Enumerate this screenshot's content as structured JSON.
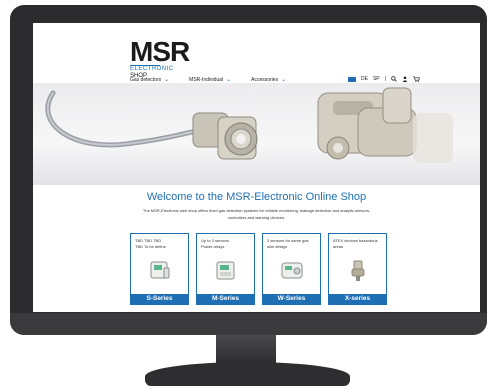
{
  "logo": {
    "main": "MSR",
    "line2": "ELECTRONIC",
    "line3": "SHOP"
  },
  "nav": [
    {
      "label": "Gas detectors"
    },
    {
      "label": "MSR-Individual"
    },
    {
      "label": "Accessories"
    }
  ],
  "utility": {
    "lang1": "DE",
    "lang2": "SP"
  },
  "welcome_title": "Welcome to the MSR-Electronic Online Shop",
  "description": [
    "The MSR-Electronic web shop offers fixed gas detection systems for reliable monitoring, leakage detection and analytic sensors,",
    "controllers and warning devices."
  ],
  "cards": [
    {
      "text": [
        "TBD TBD TBD",
        "TBD To be define"
      ],
      "label": "S-Series"
    },
    {
      "text": [
        "Up to 3 sensors",
        "Power-relays"
      ],
      "label": "M-Series"
    },
    {
      "text": [
        "2 sensors for same gas",
        "slim design"
      ],
      "label": "W-Series"
    },
    {
      "text": [
        "ATEX devices hazardous",
        "areas"
      ],
      "label": "X-series"
    }
  ],
  "colors": {
    "brand_blue": "#1f6fb4",
    "monitor": "#2b2b2e"
  }
}
